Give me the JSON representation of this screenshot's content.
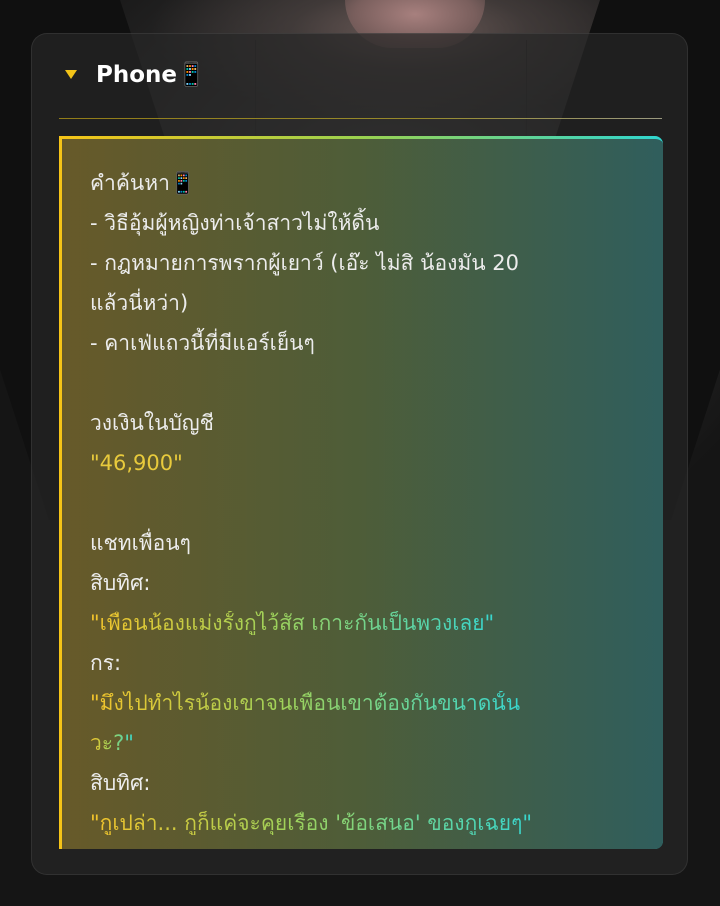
{
  "panel": {
    "title": "Phone📱"
  },
  "search": {
    "heading": "คำค้นหา📱",
    "items": [
      "- วิธีอุ้มผู้หญิงท่าเจ้าสาวไม่ให้ดิ้น",
      "- กฎหมายการพรากผู้เยาว์ (เอ๊ะ ไม่สิ น้องมัน 20",
      "แล้วนี่หว่า)",
      "- คาเฟ่แถวนี้ที่มีแอร์เย็นๆ"
    ]
  },
  "balance": {
    "heading": "วงเงินในบัญชี",
    "value": "\"46,900\""
  },
  "chat": {
    "heading": "แชทเพื่อนๆ",
    "messages": [
      {
        "sender": "สิบทิศ:",
        "lines": [
          "\"เพื่อนน้องแม่งรั้งกูไว้สัส เกาะกันเป็นพวงเลย\""
        ]
      },
      {
        "sender": "กร:",
        "lines": [
          "\"มึงไปทำไรน้องเขาจนเพื่อนเขาต้องกันขนาดนั้น",
          "วะ?\""
        ]
      },
      {
        "sender": "สิบทิศ:",
        "lines": [
          "\"กูเปล่า... กูก็แค่จะคุยเรื่อง 'ข้อเสนอ' ของกูเฉยๆ\""
        ]
      }
    ]
  },
  "colors": {
    "accent_yellow": "#f6c417",
    "accent_green": "#9bd24f",
    "accent_cyan": "#2fd6d0"
  }
}
